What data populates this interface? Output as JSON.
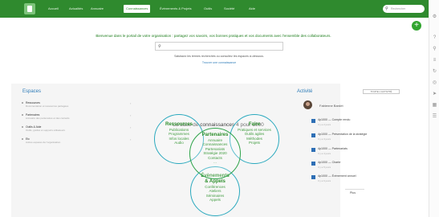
{
  "topnav": {
    "items": [
      "Accueil",
      "Actualités",
      "Annuaire",
      "Connaissances",
      "Événements & Projets",
      "Outils",
      "Société",
      "Aide"
    ],
    "active_index": 3,
    "search_placeholder": "Rechercher"
  },
  "welcome": {
    "text": "Bienvenue dans le portail de votre organisation : partagez vos savoirs, vos bonnes pratiques et vos documents avec l'ensemble des collaborateurs.",
    "search_hint": "Saisissez les termes recherchés ou consultez les espaces ci-dessous.",
    "search_link": "Trouver une connaissance"
  },
  "spaces": {
    "title": "Espaces",
    "items": [
      {
        "name": "Ressources",
        "desc": "Documentation et ressources partagées"
      },
      {
        "name": "Partenaires",
        "desc": "Annuaire des partenaires et des contacts"
      },
      {
        "name": "Outils & Aide",
        "desc": "Outils, guides et supports utilisateurs"
      },
      {
        "name": "Etc",
        "desc": "Autres espaces de l'organisation"
      }
    ]
  },
  "kb": {
    "title": "La base de connaissances 4 pour 1000",
    "circles": {
      "ressources": {
        "title": "Ressources",
        "items": [
          "Publications",
          "Programmes",
          "Infos locales",
          "Audio"
        ]
      },
      "partenaires": {
        "title": "Partenaires",
        "items": [
          "Annuaire",
          "Connaissances",
          "Partenariats",
          "Stratégie 2020",
          "Contacts",
          "..."
        ]
      },
      "faire": {
        "title": "Faire",
        "items": [
          "Pratiques et services",
          "Outils agiles",
          "Méthodes",
          "Projets"
        ]
      },
      "evenements": {
        "title": "Évènements & Appels",
        "items": [
          "Conférences",
          "Ateliers",
          "Séminaires",
          "Appels"
        ]
      }
    }
  },
  "activity": {
    "title": "Activité",
    "button_label": "TOUTE L'ACTIVITÉ",
    "user": "Fabienne Bardet",
    "items": [
      {
        "name": "4p1000 — Compte rendu",
        "date": "Il y a 2 jours"
      },
      {
        "name": "4p1000 — Présentation de la stratégie",
        "date": "Il y a 3 jours"
      },
      {
        "name": "4p1000 — Partenariats",
        "date": "Il y a 4 jours"
      },
      {
        "name": "4p1000 — Charte",
        "date": "Il y a 5 jours"
      },
      {
        "name": "4p1000 — Évènement annuel",
        "date": "Il y a 6 jours"
      }
    ],
    "more_label": "Plus"
  },
  "icons": {
    "logo": "logo-icon",
    "search": "search-icon",
    "add": "plus-icon",
    "rightbar": [
      "gear-icon",
      "question-icon",
      "search-icon",
      "filter-icon",
      "refresh-icon",
      "settings-icon",
      "share-icon",
      "grid-icon",
      "stack-icon"
    ]
  },
  "colors": {
    "nav_green": "#2f8a2e",
    "accent_green": "#32a530",
    "circle_blue": "#2aa9be",
    "link_blue": "#2e7cb8",
    "doc_blue": "#2e6fb5"
  }
}
